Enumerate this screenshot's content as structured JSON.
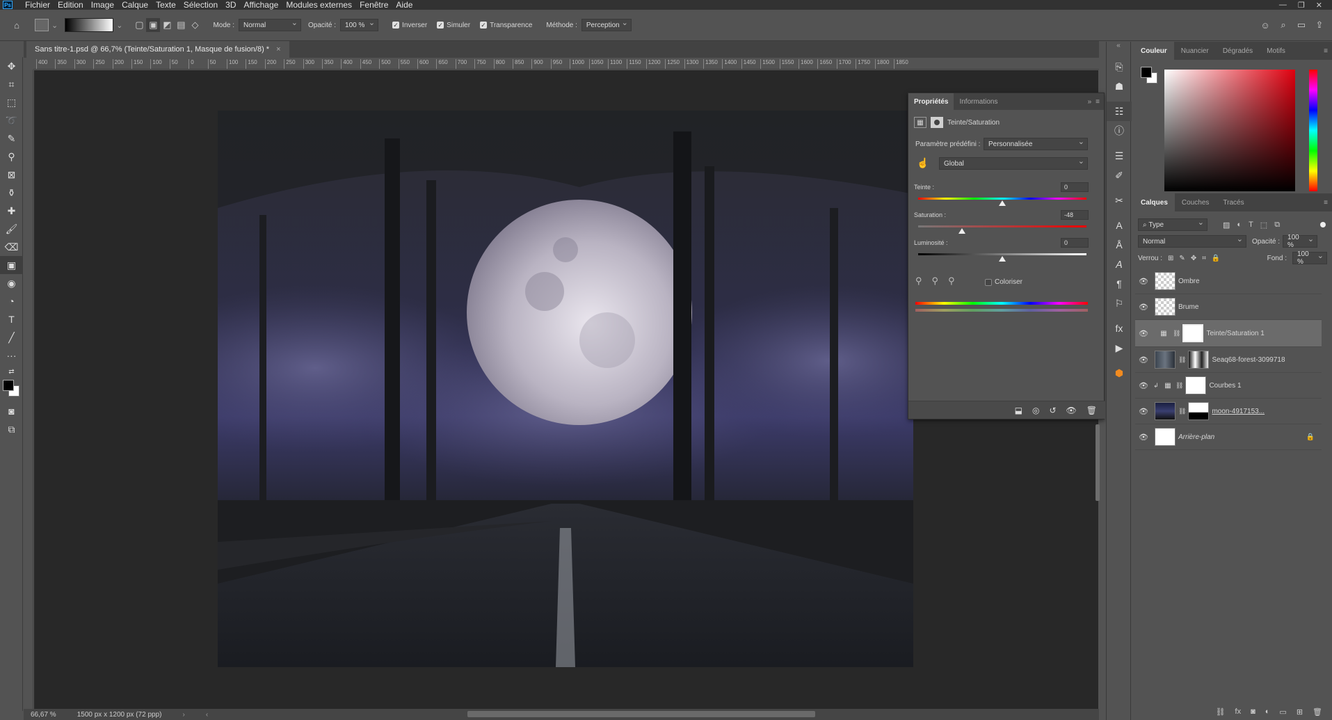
{
  "menu": {
    "app_icon": "Ps",
    "items": [
      "Fichier",
      "Edition",
      "Image",
      "Calque",
      "Texte",
      "Sélection",
      "3D",
      "Affichage",
      "Modules externes",
      "Fenêtre",
      "Aide"
    ]
  },
  "options": {
    "mode_label": "Mode :",
    "mode_value": "Normal",
    "opacity_label": "Opacité :",
    "opacity_value": "100 %",
    "reverse_label": "Inverser",
    "simulate_label": "Simuler",
    "transparency_label": "Transparence",
    "method_label": "Méthode :",
    "method_value": "Perception"
  },
  "document": {
    "tab_title": "Sans titre-1.psd @ 66,7% (Teinte/Saturation 1, Masque de fusion/8) *",
    "zoom": "66,67 %",
    "doc_size": "1500 px x 1200 px (72 ppp)"
  },
  "ruler_labels": [
    "400",
    "350",
    "300",
    "250",
    "200",
    "150",
    "100",
    "50",
    "0",
    "50",
    "100",
    "150",
    "200",
    "250",
    "300",
    "350",
    "400",
    "450",
    "500",
    "550",
    "600",
    "650",
    "700",
    "750",
    "800",
    "850",
    "900",
    "950",
    "1000",
    "1050",
    "1100",
    "1150",
    "1200",
    "1250",
    "1300",
    "1350",
    "1400",
    "1450",
    "1500",
    "1550",
    "1600",
    "1650",
    "1700",
    "1750",
    "1800",
    "1850"
  ],
  "properties": {
    "tabs": [
      "Propriétés",
      "Informations"
    ],
    "adjustment_title": "Teinte/Saturation",
    "preset_label": "Paramètre prédéfini :",
    "preset_value": "Personnalisée",
    "range_value": "Global",
    "hue_label": "Teinte :",
    "hue_value": "0",
    "hue_level": 0.5,
    "saturation_label": "Saturation :",
    "saturation_value": "-48",
    "saturation_level": 0.26,
    "lightness_label": "Luminosité :",
    "lightness_value": "0",
    "lightness_level": 0.5,
    "colorize_label": "Coloriser"
  },
  "color_panel": {
    "tabs": [
      "Couleur",
      "Nuancier",
      "Dégradés",
      "Motifs"
    ],
    "hue_color": "#e0000f"
  },
  "layers_panel": {
    "tabs": [
      "Calques",
      "Couches",
      "Tracés"
    ],
    "filter_value": "Type",
    "blend_value": "Normal",
    "opacity_label": "Opacité :",
    "opacity_value": "100 %",
    "lock_label": "Verrou :",
    "fill_label": "Fond :",
    "fill_value": "100 %",
    "layers": [
      {
        "name": "Ombre"
      },
      {
        "name": "Brume"
      },
      {
        "name": "Teinte/Saturation 1"
      },
      {
        "name": "Seaq68-forest-3099718"
      },
      {
        "name": "Courbes 1"
      },
      {
        "name": "moon-4917153..."
      },
      {
        "name": "Arrière-plan"
      }
    ]
  }
}
